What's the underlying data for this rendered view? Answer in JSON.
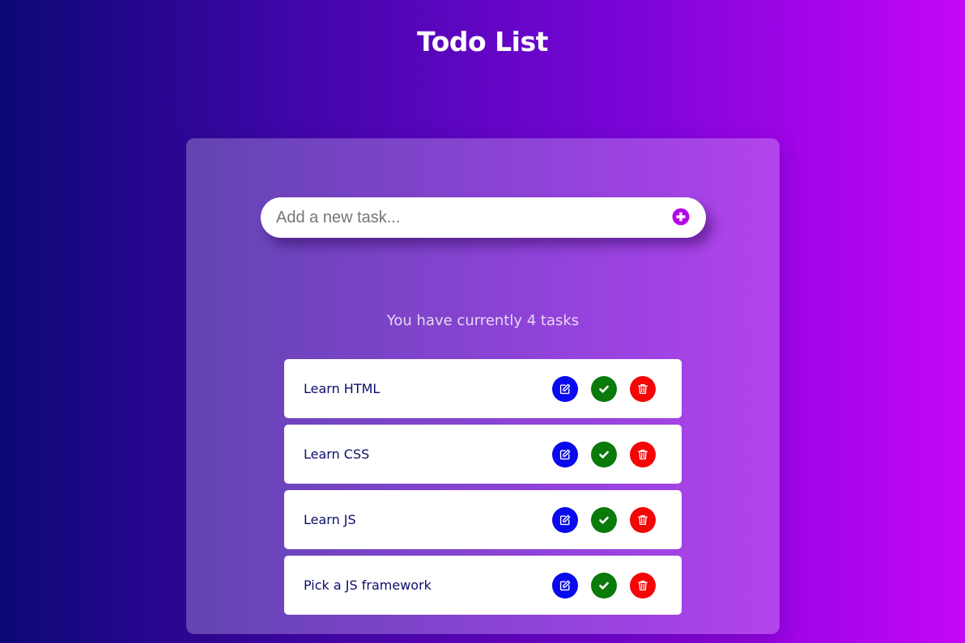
{
  "header": {
    "title": "Todo List"
  },
  "input": {
    "placeholder": "Add a new task...",
    "value": ""
  },
  "add_button": {
    "icon": "plus-circle-icon"
  },
  "summary": {
    "text": "You have currently 4 tasks"
  },
  "tasks": [
    {
      "label": "Learn HTML"
    },
    {
      "label": "Learn CSS"
    },
    {
      "label": "Learn JS"
    },
    {
      "label": "Pick a JS framework"
    }
  ],
  "actions": {
    "edit_icon": "edit-icon",
    "done_icon": "check-icon",
    "delete_icon": "trash-icon"
  },
  "colors": {
    "edit": "#0a0aee",
    "done": "#0a7a0a",
    "delete": "#f40606",
    "accent": "#c406f5",
    "task_text": "#0d0d6b"
  }
}
